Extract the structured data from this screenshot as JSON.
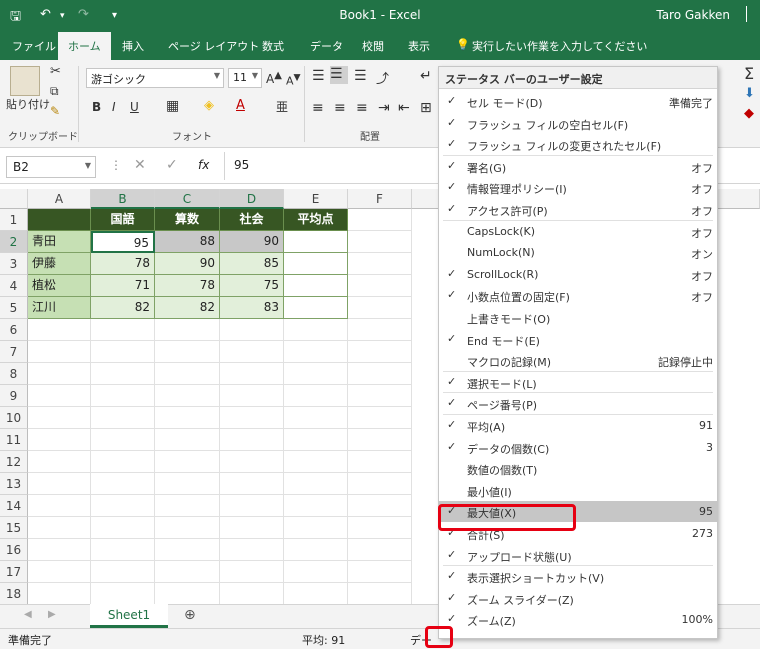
{
  "title_bar": {
    "doc_title": "Book1 - Excel",
    "user": "Taro Gakken"
  },
  "tabs": [
    "ファイル",
    "ホーム",
    "挿入",
    "ページ レイアウト",
    "数式",
    "データ",
    "校閲",
    "表示"
  ],
  "tell_me": "実行したい作業を入力してください",
  "ribbon": {
    "paste_label": "貼り付け",
    "font_name": "游ゴシック",
    "font_size": "11",
    "bold": "B",
    "italic": "I",
    "underline": "U",
    "groups": {
      "clipboard": "クリップボード",
      "font": "フォント",
      "alignment": "配置"
    }
  },
  "formula_bar": {
    "name_box": "B2",
    "fx": "fx",
    "value": "95"
  },
  "columns": [
    "A",
    "B",
    "C",
    "D",
    "E",
    "F"
  ],
  "rows": [
    "1",
    "2",
    "3",
    "4",
    "5",
    "6",
    "7",
    "8",
    "9",
    "10",
    "11",
    "12",
    "13",
    "14",
    "15",
    "16",
    "17",
    "18"
  ],
  "table": {
    "headers": [
      "",
      "国語",
      "算数",
      "社会",
      "平均点"
    ],
    "data": [
      [
        "青田",
        "95",
        "88",
        "90",
        ""
      ],
      [
        "伊藤",
        "78",
        "90",
        "85",
        ""
      ],
      [
        "植松",
        "71",
        "78",
        "75",
        ""
      ],
      [
        "江川",
        "82",
        "82",
        "83",
        ""
      ]
    ]
  },
  "sheet_tab": "Sheet1",
  "status": {
    "mode": "準備完了",
    "average": "平均: 91",
    "count_partial": "デー",
    "partial2": "最大値: 95",
    "partial3": "合計: 273"
  },
  "menu": {
    "title": "ステータス バーのユーザー設定",
    "items": [
      {
        "check": "✓",
        "label": "セル モード(D)",
        "value": "準備完了"
      },
      {
        "check": "✓",
        "label": "フラッシュ フィルの空白セル(F)",
        "value": ""
      },
      {
        "check": "✓",
        "label": "フラッシュ フィルの変更されたセル(F)",
        "value": ""
      },
      {
        "check": "✓",
        "label": "署名(G)",
        "value": "オフ"
      },
      {
        "check": "✓",
        "label": "情報管理ポリシー(I)",
        "value": "オフ"
      },
      {
        "check": "✓",
        "label": "アクセス許可(P)",
        "value": "オフ"
      },
      {
        "check": "",
        "label": "CapsLock(K)",
        "value": "オフ"
      },
      {
        "check": "",
        "label": "NumLock(N)",
        "value": "オン"
      },
      {
        "check": "✓",
        "label": "ScrollLock(R)",
        "value": "オフ"
      },
      {
        "check": "✓",
        "label": "小数点位置の固定(F)",
        "value": "オフ"
      },
      {
        "check": "",
        "label": "上書きモード(O)",
        "value": ""
      },
      {
        "check": "✓",
        "label": "End モード(E)",
        "value": ""
      },
      {
        "check": "",
        "label": "マクロの記録(M)",
        "value": "記録停止中"
      },
      {
        "check": "✓",
        "label": "選択モード(L)",
        "value": ""
      },
      {
        "check": "✓",
        "label": "ページ番号(P)",
        "value": ""
      },
      {
        "check": "✓",
        "label": "平均(A)",
        "value": "91"
      },
      {
        "check": "✓",
        "label": "データの個数(C)",
        "value": "3"
      },
      {
        "check": "",
        "label": "数値の個数(T)",
        "value": ""
      },
      {
        "check": "",
        "label": "最小値(I)",
        "value": ""
      },
      {
        "check": "✓",
        "label": "最大値(X)",
        "value": "95"
      },
      {
        "check": "✓",
        "label": "合計(S)",
        "value": "273"
      },
      {
        "check": "✓",
        "label": "アップロード状態(U)",
        "value": ""
      },
      {
        "check": "✓",
        "label": "表示選択ショートカット(V)",
        "value": ""
      },
      {
        "check": "✓",
        "label": "ズーム スライダー(Z)",
        "value": ""
      },
      {
        "check": "✓",
        "label": "ズーム(Z)",
        "value": "100%"
      }
    ]
  },
  "colors": {
    "excel_green": "#217346",
    "header_fill": "#375623",
    "name_fill": "#c6e0b4",
    "data_fill": "#e2efda",
    "highlight": "#e60012"
  }
}
